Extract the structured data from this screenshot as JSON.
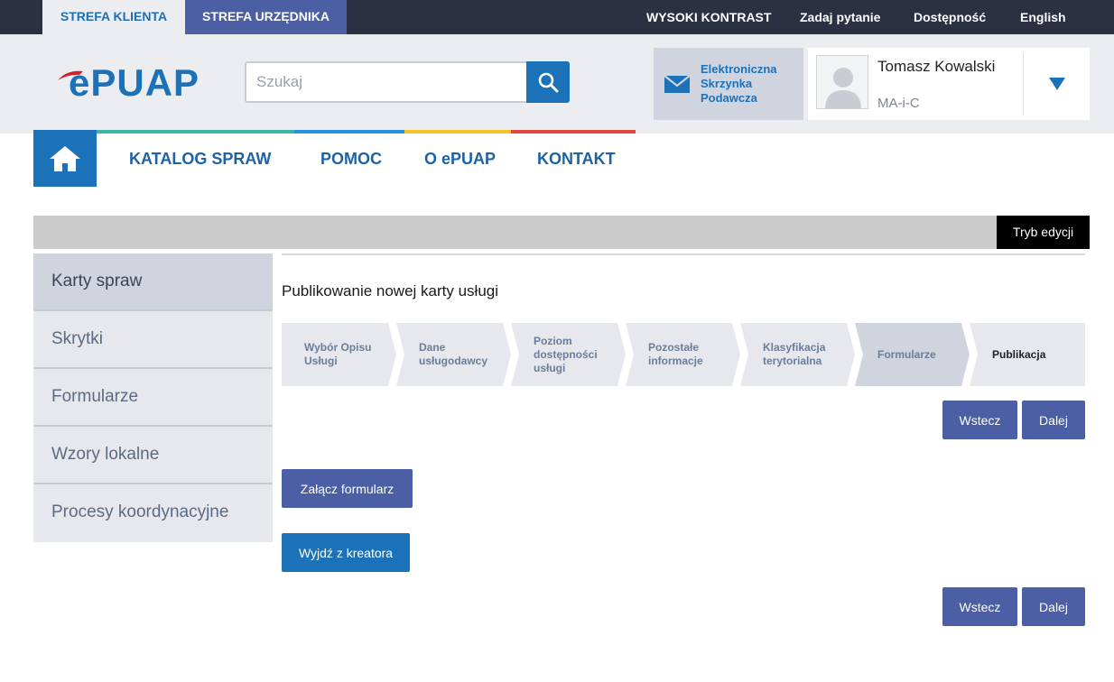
{
  "topbar": {
    "zone_client": "STREFA KLIENTA",
    "zone_official": "STREFA URZĘDNIKA",
    "links": [
      "WYSOKI KONTRAST",
      "Zadaj pytanie",
      "Dostępność",
      "English"
    ]
  },
  "header": {
    "logo_text": "ePUAP",
    "search_placeholder": "Szukaj",
    "esp_label": "Elektroniczna Skrzynka Podawcza",
    "user_name": "Tomasz Kowalski",
    "user_role": "MA-i-C"
  },
  "nav": {
    "items": [
      "KATALOG SPRAW",
      "POMOC",
      "O ePUAP",
      "KONTAKT"
    ]
  },
  "edit_mode_label": "Tryb edycji",
  "sidebar": {
    "items": [
      "Karty spraw",
      "Skrytki",
      "Formularze",
      "Wzory lokalne",
      "Procesy koordynacyjne"
    ]
  },
  "main": {
    "title": "Publikowanie nowej karty usługi",
    "steps": [
      "Wybór Opisu Usługi",
      "Dane usługodawcy",
      "Poziom dostępności usługi",
      "Pozostałe informacje",
      "Klasyfikacja terytorialna",
      "Formularze",
      "Publikacja"
    ],
    "active_step": "Formularze",
    "back_label": "Wstecz",
    "next_label": "Dalej",
    "attach_form_label": "Załącz formularz",
    "exit_wizard_label": "Wyjdź z kreatora"
  },
  "colors": {
    "primary_blue": "#1c72b8",
    "purple": "#4c5ea4",
    "topbar_dark": "#2b3042",
    "header_bg": "#ebedf1"
  }
}
